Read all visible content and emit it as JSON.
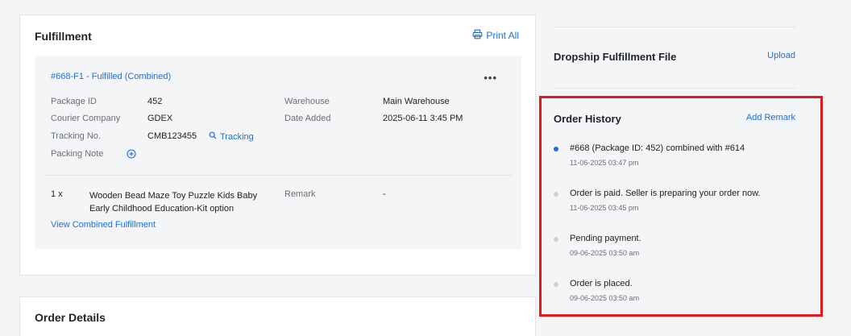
{
  "fulfillment": {
    "title": "Fulfillment",
    "print_all": "Print All",
    "item_header": "#668-F1 - Fulfilled  (Combined)",
    "more": "•••",
    "fields": {
      "package_id_label": "Package ID",
      "package_id": "452",
      "courier_label": "Courier Company",
      "courier": "GDEX",
      "tracking_label": "Tracking No.",
      "tracking_no": "CMB123455",
      "tracking_link": "Tracking",
      "packing_note_label": "Packing Note",
      "warehouse_label": "Warehouse",
      "warehouse": "Main Warehouse",
      "date_added_label": "Date Added",
      "date_added": "2025-06-11 3:45 PM"
    },
    "line_item": {
      "qty": "1 x",
      "name": "Wooden Bead Maze Toy Puzzle Kids Baby Early Childhood Education-Kit option",
      "remark_label": "Remark",
      "remark": "-"
    },
    "view_combined": "View Combined Fulfillment"
  },
  "order_details": {
    "title": "Order Details"
  },
  "dropship": {
    "title": "Dropship Fulfillment File",
    "upload": "Upload"
  },
  "history": {
    "title": "Order History",
    "add_remark": "Add Remark",
    "items": [
      {
        "text": "#668 (Package ID: 452) combined with #614",
        "time": "11-06-2025 03:47 pm",
        "active": true
      },
      {
        "text": "Order is paid. Seller is preparing your order now.",
        "time": "11-06-2025 03:45 pm",
        "active": false
      },
      {
        "text": "Pending payment.",
        "time": "09-06-2025 03:50 am",
        "active": false
      },
      {
        "text": "Order is placed.",
        "time": "09-06-2025 03:50 am",
        "active": false
      }
    ]
  },
  "colors": {
    "accent": "#1e6fd9",
    "highlight_border": "#e0191d",
    "inactive_dot": "#cdd0d4"
  },
  "icons": {
    "print": "printer-icon",
    "tracking": "search-icon",
    "add_note": "plus-circle-icon",
    "more": "more-horizontal-icon"
  }
}
